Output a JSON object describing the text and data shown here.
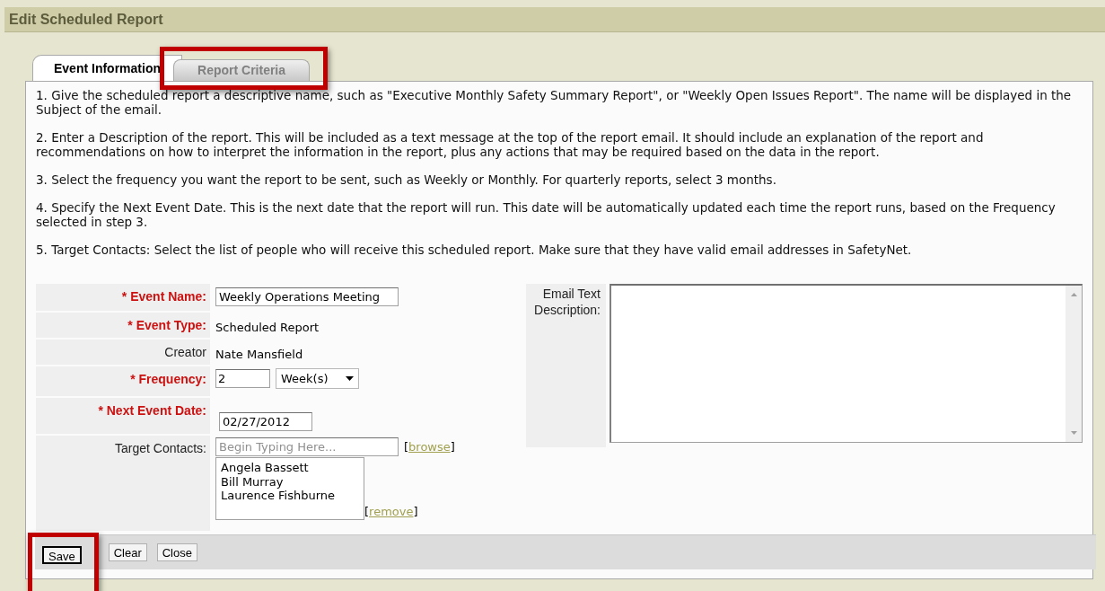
{
  "window": {
    "title": "Edit Scheduled Report"
  },
  "tabs": [
    {
      "label": "Event Information",
      "selected": true,
      "highlighted": false
    },
    {
      "label": "Report Criteria",
      "selected": false,
      "highlighted": true
    }
  ],
  "instructions": [
    "1. Give the scheduled report a descriptive name, such as \"Executive Monthly Safety Summary Report\", or \"Weekly Open Issues Report\". The name will be displayed in the Subject of the email.",
    "2. Enter a Description of the report. This will be included as a text message at the top of the report email. It should include an explanation of the report and recommendations on how to interpret the information in the report, plus any actions that may be required based on the data in the report.",
    "3. Select the frequency you want the report to be sent, such as Weekly or Monthly. For quarterly reports, select 3 months.",
    "4. Specify the Next Event Date. This is the next date that the report will run. This date will be automatically updated each time the report runs, based on the Frequency selected in step 3.",
    "5. Target Contacts: Select the list of people who will receive this scheduled report. Make sure that they have valid email addresses in SafetyNet."
  ],
  "fields": [
    {
      "label": "* Event Name:",
      "required": true,
      "kind": "input",
      "value": "Weekly Operations Meeting"
    },
    {
      "label": "* Event Type:",
      "required": true,
      "kind": "text",
      "value": "Scheduled Report"
    },
    {
      "label": "Creator",
      "required": false,
      "kind": "text",
      "value": "Nate Mansfield"
    },
    {
      "label": "* Frequency:",
      "required": true,
      "kind": "frequency",
      "value": "2",
      "unit": "Week(s)"
    },
    {
      "label": "* Next Event Date:",
      "required": true,
      "kind": "date",
      "value": "02/27/2012"
    },
    {
      "label": "Target Contacts:",
      "required": false,
      "kind": "contacts",
      "placeholder": "Begin Typing Here...",
      "browse": {
        "before": "[",
        "label": "browse",
        "after": "]"
      },
      "contacts": [
        "Angela Bassett",
        "Bill Murray",
        "Laurence Fishburne"
      ],
      "remove": {
        "before": "[",
        "label": "remove",
        "after": "]"
      }
    }
  ],
  "email_description": {
    "label": "Email Text Description:"
  },
  "buttons": [
    {
      "label": "Save",
      "highlighted": true
    },
    {
      "label": "Clear",
      "highlighted": false
    },
    {
      "label": "Close",
      "highlighted": false
    }
  ]
}
